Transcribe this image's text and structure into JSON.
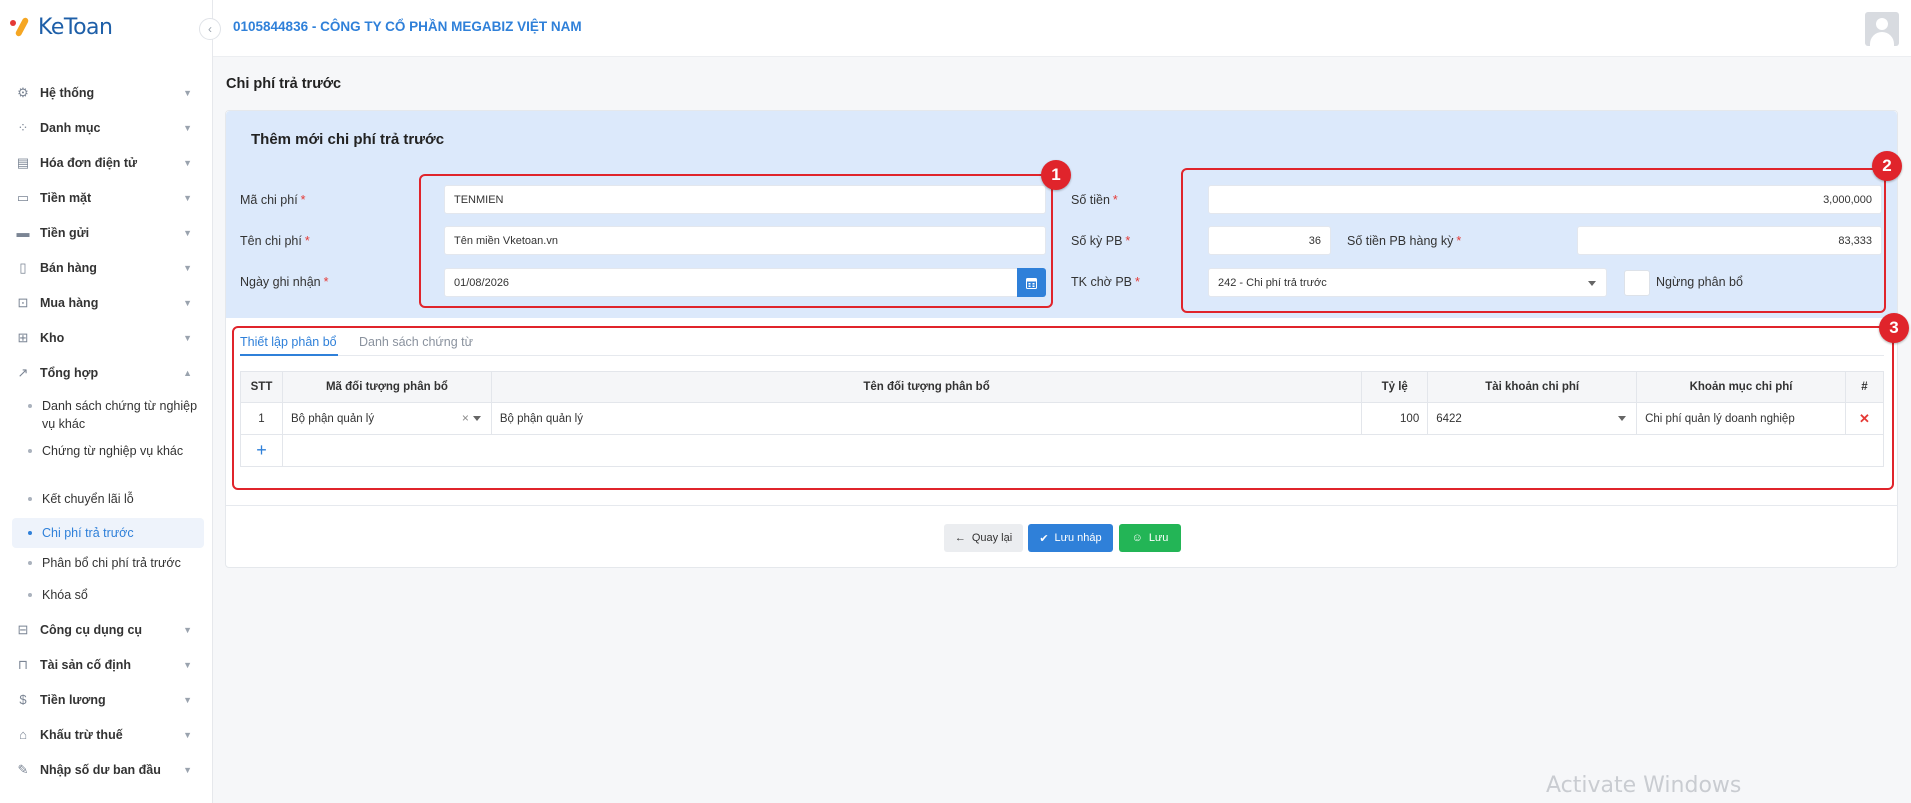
{
  "app": {
    "logo_text": "KeToan"
  },
  "header": {
    "company": "0105844836 - CÔNG TY CỔ PHẦN MEGABIZ VIỆT NAM"
  },
  "sidebar": {
    "items": [
      {
        "label": "Hệ thống",
        "icon": "gear-icon"
      },
      {
        "label": "Danh mục",
        "icon": "grid-icon"
      },
      {
        "label": "Hóa đơn điện tử",
        "icon": "invoice-icon"
      },
      {
        "label": "Tiền mặt",
        "icon": "cash-icon"
      },
      {
        "label": "Tiền gửi",
        "icon": "card-icon"
      },
      {
        "label": "Bán hàng",
        "icon": "sales-icon"
      },
      {
        "label": "Mua hàng",
        "icon": "cart-icon"
      },
      {
        "label": "Kho",
        "icon": "warehouse-icon"
      },
      {
        "label": "Tổng hợp",
        "icon": "chart-icon"
      }
    ],
    "sub_items": [
      {
        "label": "Danh sách chứng từ nghiệp vụ khác"
      },
      {
        "label": "Chứng từ nghiệp vụ khác"
      },
      {
        "label": "Kết chuyển lãi lỗ"
      },
      {
        "label": "Chi phí trả trước"
      },
      {
        "label": "Phân bổ chi phí trả trước"
      },
      {
        "label": "Khóa sổ"
      }
    ],
    "items_after": [
      {
        "label": "Công cụ dụng cụ",
        "icon": "tools-icon"
      },
      {
        "label": "Tài sản cố định",
        "icon": "car-icon"
      },
      {
        "label": "Tiền lương",
        "icon": "salary-icon"
      },
      {
        "label": "Khấu trừ thuế",
        "icon": "bank-icon"
      },
      {
        "label": "Nhập số dư ban đầu",
        "icon": "edit-icon"
      }
    ]
  },
  "page": {
    "title": "Chi phí trả trước"
  },
  "form": {
    "title": "Thêm mới chi phí trả trước",
    "ma_chi_phi": {
      "label": "Mã chi phí",
      "value": "TENMIEN"
    },
    "ten_chi_phi": {
      "label": "Tên chi phí",
      "value": "Tên miền Vketoan.vn"
    },
    "ngay_ghi_nhan": {
      "label": "Ngày ghi nhận",
      "value": "01/08/2026"
    },
    "so_tien": {
      "label": "Số tiền",
      "value": "3,000,000"
    },
    "so_ky_pb": {
      "label": "Số kỳ PB",
      "value": "36"
    },
    "so_tien_pb_hang_ky": {
      "label": "Số tiền PB hàng kỳ",
      "value": "83,333"
    },
    "tk_cho_pb": {
      "label": "TK chờ PB",
      "value": "242 - Chi phí trả trước"
    },
    "ngung_phan_bo": {
      "label": "Ngừng phân bổ",
      "checked": false
    }
  },
  "annotations": [
    "1",
    "2",
    "3"
  ],
  "tabs": [
    {
      "label": "Thiết lập phân bổ",
      "active": true
    },
    {
      "label": "Danh sách chứng từ",
      "active": false
    }
  ],
  "table": {
    "headers": [
      "STT",
      "Mã đối tượng phân bổ",
      "Tên đối tượng phân bổ",
      "Tỷ lệ",
      "Tài khoản chi phí",
      "Khoản mục chi phí",
      "#"
    ],
    "rows": [
      {
        "stt": "1",
        "ma": "Bộ phận quản lý",
        "ten": "Bộ phận quản lý",
        "ty_le": "100",
        "tai_khoan": "6422",
        "khoan_muc": "Chi phí quản lý doanh nghiệp"
      }
    ],
    "add_symbol": "+"
  },
  "buttons": {
    "back": "Quay lại",
    "draft": "Lưu nháp",
    "save": "Lưu"
  },
  "watermark": "Activate Windows",
  "colors": {
    "accent": "#2f80d9",
    "annotation": "#e0242b",
    "save": "#23b556",
    "form_bg": "#dce9fb"
  }
}
